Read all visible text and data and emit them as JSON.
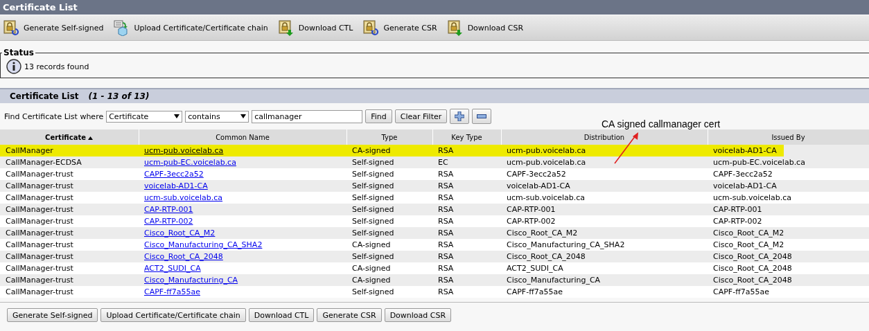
{
  "window": {
    "title": "Certificate List"
  },
  "toolbar": [
    {
      "label": "Generate Self-signed",
      "kind": "generate"
    },
    {
      "label": "Upload Certificate/Certificate chain",
      "kind": "upload"
    },
    {
      "label": "Download CTL",
      "kind": "download"
    },
    {
      "label": "Generate CSR",
      "kind": "generate"
    },
    {
      "label": "Download CSR",
      "kind": "download"
    }
  ],
  "status": {
    "legend": "Status",
    "message": "13 records found"
  },
  "list": {
    "title": "Certificate List",
    "range": "(1 - 13 of 13)"
  },
  "find": {
    "label": "Find Certificate List where",
    "field": "Certificate",
    "operator": "contains",
    "value": "callmanager",
    "buttons": [
      "Find",
      "Clear Filter"
    ]
  },
  "annotation": "CA signed callmanager cert",
  "table": {
    "columns": [
      {
        "label": "Certificate",
        "sorted": true
      },
      {
        "label": "Common Name",
        "sorted": false
      },
      {
        "label": "Type",
        "sorted": false
      },
      {
        "label": "Key Type",
        "sorted": false
      },
      {
        "label": "Distribution",
        "sorted": false
      },
      {
        "label": "Issued By",
        "sorted": false
      }
    ],
    "rows": [
      {
        "cells": [
          "CallManager",
          "ucm-pub.voicelab.ca",
          "CA-signed",
          "RSA",
          "ucm-pub.voicelab.ca",
          "voicelab-AD1-CA"
        ],
        "selected": true
      },
      {
        "cells": [
          "CallManager-ECDSA",
          "ucm-pub-EC.voicelab.ca",
          "Self-signed",
          "EC",
          "ucm-pub.voicelab.ca",
          "ucm-pub-EC.voicelab.ca"
        ],
        "selected": false
      },
      {
        "cells": [
          "CallManager-trust",
          "CAPF-3ecc2a52",
          "Self-signed",
          "RSA",
          "CAPF-3ecc2a52",
          "CAPF-3ecc2a52"
        ],
        "selected": false
      },
      {
        "cells": [
          "CallManager-trust",
          "voicelab-AD1-CA",
          "Self-signed",
          "RSA",
          "voicelab-AD1-CA",
          "voicelab-AD1-CA"
        ],
        "selected": false
      },
      {
        "cells": [
          "CallManager-trust",
          "ucm-sub.voicelab.ca",
          "Self-signed",
          "RSA",
          "ucm-sub.voicelab.ca",
          "ucm-sub.voicelab.ca"
        ],
        "selected": false
      },
      {
        "cells": [
          "CallManager-trust",
          "CAP-RTP-001",
          "Self-signed",
          "RSA",
          "CAP-RTP-001",
          "CAP-RTP-001"
        ],
        "selected": false
      },
      {
        "cells": [
          "CallManager-trust",
          "CAP-RTP-002",
          "Self-signed",
          "RSA",
          "CAP-RTP-002",
          "CAP-RTP-002"
        ],
        "selected": false
      },
      {
        "cells": [
          "CallManager-trust",
          "Cisco_Root_CA_M2",
          "Self-signed",
          "RSA",
          "Cisco_Root_CA_M2",
          "Cisco_Root_CA_M2"
        ],
        "selected": false
      },
      {
        "cells": [
          "CallManager-trust",
          "Cisco_Manufacturing_CA_SHA2",
          "CA-signed",
          "RSA",
          "Cisco_Manufacturing_CA_SHA2",
          "Cisco_Root_CA_M2"
        ],
        "selected": false
      },
      {
        "cells": [
          "CallManager-trust",
          "Cisco_Root_CA_2048",
          "Self-signed",
          "RSA",
          "Cisco_Root_CA_2048",
          "Cisco_Root_CA_2048"
        ],
        "selected": false
      },
      {
        "cells": [
          "CallManager-trust",
          "ACT2_SUDI_CA",
          "CA-signed",
          "RSA",
          "ACT2_SUDI_CA",
          "Cisco_Root_CA_2048"
        ],
        "selected": false
      },
      {
        "cells": [
          "CallManager-trust",
          "Cisco_Manufacturing_CA",
          "CA-signed",
          "RSA",
          "Cisco_Manufacturing_CA",
          "Cisco_Root_CA_2048"
        ],
        "selected": false
      },
      {
        "cells": [
          "CallManager-trust",
          "CAPF-ff7a55ae",
          "Self-signed",
          "RSA",
          "CAPF-ff7a55ae",
          "CAPF-ff7a55ae"
        ],
        "selected": false
      }
    ]
  },
  "bottom_buttons": [
    "Generate Self-signed",
    "Upload Certificate/Certificate chain",
    "Download CTL",
    "Generate CSR",
    "Download CSR"
  ]
}
